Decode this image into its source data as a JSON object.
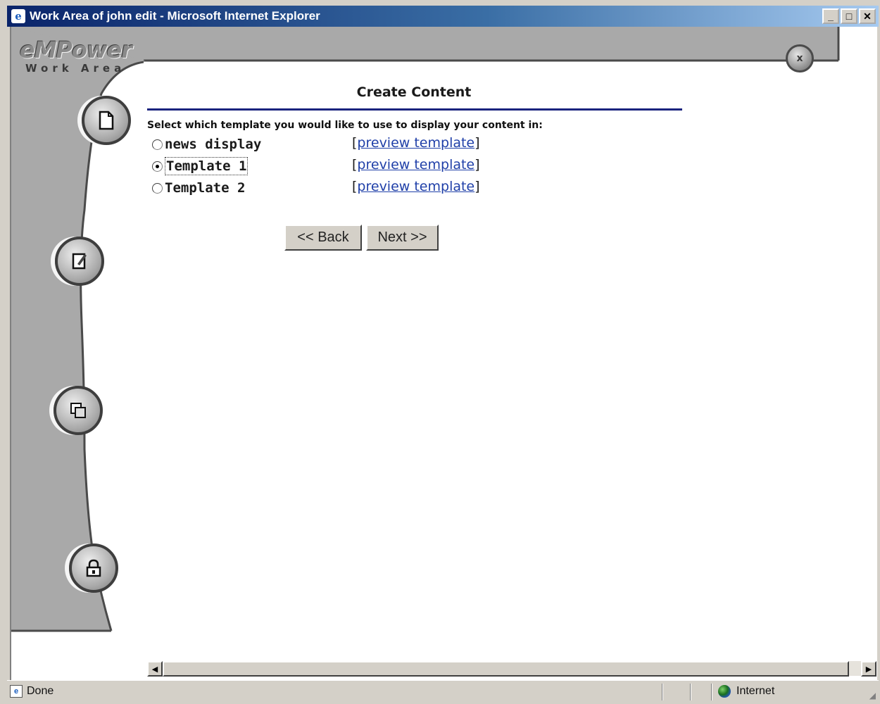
{
  "window": {
    "title": "Work Area of john edit - Microsoft Internet Explorer",
    "minimize": "_",
    "maximize": "□",
    "close": "✕"
  },
  "branding": {
    "logo": "eMPower",
    "subtitle": "Work Area"
  },
  "close_button": "x",
  "nav_icons": [
    "document-icon",
    "edit-icon",
    "copy-icon",
    "lock-icon"
  ],
  "page": {
    "title": "Create Content",
    "instructions": "Select which template you would like to use to display your content in:"
  },
  "templates": [
    {
      "label": "news display",
      "selected": false,
      "link": "preview template"
    },
    {
      "label": "Template 1",
      "selected": true,
      "link": "preview template"
    },
    {
      "label": "Template 2",
      "selected": false,
      "link": "preview template"
    }
  ],
  "buttons": {
    "back": "<< Back",
    "next": "Next >>"
  },
  "status": {
    "text": "Done",
    "zone": "Internet"
  },
  "colors": {
    "title_rule": "#1a237e",
    "link": "#1f3fa8",
    "chrome": "#a9a9a9"
  }
}
